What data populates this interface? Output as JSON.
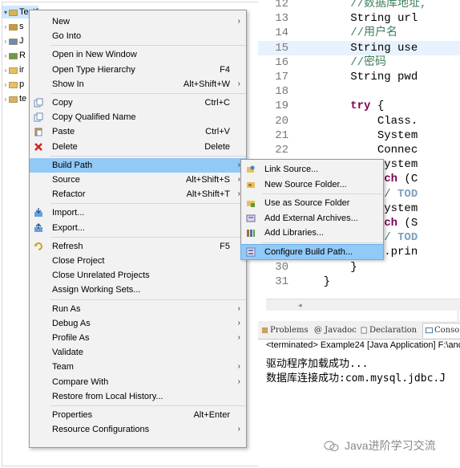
{
  "explorer": {
    "rows": [
      {
        "arrow": "▾",
        "label": "Test01"
      },
      {
        "arrow": "›",
        "label": "s"
      },
      {
        "arrow": "›",
        "label": "J"
      },
      {
        "arrow": "›",
        "label": "R"
      },
      {
        "arrow": "›",
        "label": "ir"
      },
      {
        "arrow": "›",
        "label": "p"
      },
      {
        "arrow": "›",
        "label": "te"
      }
    ]
  },
  "editor": {
    "lines": [
      {
        "no": "12",
        "parts": [
          {
            "t": "        ",
            "c": ""
          },
          {
            "t": "//数据库地址,",
            "c": "cmt"
          }
        ]
      },
      {
        "no": "13",
        "parts": [
          {
            "t": "        String url",
            "c": ""
          }
        ]
      },
      {
        "no": "14",
        "parts": [
          {
            "t": "        ",
            "c": ""
          },
          {
            "t": "//用户名",
            "c": "cmt"
          }
        ]
      },
      {
        "no": "15",
        "parts": [
          {
            "t": "        String use",
            "c": ""
          }
        ]
      },
      {
        "no": "16",
        "parts": [
          {
            "t": "        ",
            "c": ""
          },
          {
            "t": "//密码",
            "c": "cmt"
          }
        ]
      },
      {
        "no": "17",
        "parts": [
          {
            "t": "        String pwd",
            "c": ""
          }
        ]
      },
      {
        "no": "18",
        "parts": [
          {
            "t": "",
            "c": ""
          }
        ]
      },
      {
        "no": "19",
        "parts": [
          {
            "t": "        ",
            "c": ""
          },
          {
            "t": "try",
            "c": "kw"
          },
          {
            "t": " {",
            "c": ""
          }
        ]
      },
      {
        "no": "20",
        "parts": [
          {
            "t": "            Class.",
            "c": ""
          }
        ]
      },
      {
        "no": "21",
        "parts": [
          {
            "t": "            System",
            "c": ""
          }
        ]
      },
      {
        "no": "22",
        "parts": [
          {
            "t": "            Connec",
            "c": ""
          }
        ]
      },
      {
        "no": "23",
        "parts": [
          {
            "t": "            System",
            "c": ""
          }
        ]
      },
      {
        "no": "24",
        "parts": [
          {
            "t": "        } ",
            "c": ""
          },
          {
            "t": "catch",
            "c": "kw"
          },
          {
            "t": " (C",
            "c": ""
          }
        ]
      },
      {
        "no": "25",
        "parts": [
          {
            "t": "            // ",
            "c": "cmt"
          },
          {
            "t": "TOD",
            "c": "todo"
          }
        ]
      },
      {
        "no": "26",
        "parts": [
          {
            "t": "            System",
            "c": ""
          }
        ]
      },
      {
        "no": "27",
        "parts": [
          {
            "t": "        } ",
            "c": ""
          },
          {
            "t": "catch",
            "c": "kw"
          },
          {
            "t": " (S",
            "c": ""
          }
        ]
      },
      {
        "no": "28",
        "parts": [
          {
            "t": "            // ",
            "c": "cmt"
          },
          {
            "t": "TOD",
            "c": "todo"
          }
        ]
      },
      {
        "no": "29",
        "parts": [
          {
            "t": "            e.prin",
            "c": ""
          }
        ]
      },
      {
        "no": "30",
        "parts": [
          {
            "t": "        }",
            "c": ""
          }
        ]
      },
      {
        "no": "31",
        "parts": [
          {
            "t": "    }",
            "c": ""
          }
        ]
      }
    ]
  },
  "views": {
    "tabs": [
      "Problems",
      "@ Javadoc",
      "Declaration",
      "Conso"
    ],
    "console_header": "<terminated> Example24 [Java Application] F:\\anc",
    "console_lines": [
      "驱动程序加载成功...",
      "数据库连接成功:com.mysql.jdbc.J"
    ]
  },
  "context_menu": {
    "items": [
      {
        "label": "New",
        "accel": "",
        "submenu": true,
        "icon": ""
      },
      {
        "label": "Go Into",
        "accel": "",
        "submenu": false,
        "icon": ""
      },
      {
        "sep": true
      },
      {
        "label": "Open in New Window",
        "accel": "",
        "submenu": false,
        "icon": ""
      },
      {
        "label": "Open Type Hierarchy",
        "accel": "F4",
        "submenu": false,
        "icon": ""
      },
      {
        "label": "Show In",
        "accel": "Alt+Shift+W",
        "submenu": true,
        "icon": ""
      },
      {
        "sep": true
      },
      {
        "label": "Copy",
        "accel": "Ctrl+C",
        "submenu": false,
        "icon": "copy-icon"
      },
      {
        "label": "Copy Qualified Name",
        "accel": "",
        "submenu": false,
        "icon": "copy-icon"
      },
      {
        "label": "Paste",
        "accel": "Ctrl+V",
        "submenu": false,
        "icon": "paste-icon"
      },
      {
        "label": "Delete",
        "accel": "Delete",
        "submenu": false,
        "icon": "delete-icon"
      },
      {
        "sep": true
      },
      {
        "label": "Build Path",
        "accel": "",
        "submenu": true,
        "icon": "",
        "hover": true
      },
      {
        "label": "Source",
        "accel": "Alt+Shift+S",
        "submenu": true,
        "icon": ""
      },
      {
        "label": "Refactor",
        "accel": "Alt+Shift+T",
        "submenu": true,
        "icon": ""
      },
      {
        "sep": true
      },
      {
        "label": "Import...",
        "accel": "",
        "submenu": false,
        "icon": "import-icon"
      },
      {
        "label": "Export...",
        "accel": "",
        "submenu": false,
        "icon": "export-icon"
      },
      {
        "sep": true
      },
      {
        "label": "Refresh",
        "accel": "F5",
        "submenu": false,
        "icon": "refresh-icon"
      },
      {
        "label": "Close Project",
        "accel": "",
        "submenu": false,
        "icon": ""
      },
      {
        "label": "Close Unrelated Projects",
        "accel": "",
        "submenu": false,
        "icon": ""
      },
      {
        "label": "Assign Working Sets...",
        "accel": "",
        "submenu": false,
        "icon": ""
      },
      {
        "sep": true
      },
      {
        "label": "Run As",
        "accel": "",
        "submenu": true,
        "icon": ""
      },
      {
        "label": "Debug As",
        "accel": "",
        "submenu": true,
        "icon": ""
      },
      {
        "label": "Profile As",
        "accel": "",
        "submenu": true,
        "icon": ""
      },
      {
        "label": "Validate",
        "accel": "",
        "submenu": false,
        "icon": ""
      },
      {
        "label": "Team",
        "accel": "",
        "submenu": true,
        "icon": ""
      },
      {
        "label": "Compare With",
        "accel": "",
        "submenu": true,
        "icon": ""
      },
      {
        "label": "Restore from Local History...",
        "accel": "",
        "submenu": false,
        "icon": ""
      },
      {
        "sep": true
      },
      {
        "label": "Properties",
        "accel": "Alt+Enter",
        "submenu": false,
        "icon": ""
      },
      {
        "label": "Resource Configurations",
        "accel": "",
        "submenu": true,
        "icon": ""
      }
    ]
  },
  "build_path_menu": {
    "items": [
      {
        "label": "Link Source...",
        "icon": "link-source-icon"
      },
      {
        "label": "New Source Folder...",
        "icon": "new-source-folder-icon"
      },
      {
        "sep": true
      },
      {
        "label": "Use as Source Folder",
        "icon": "source-folder-icon"
      },
      {
        "label": "Add External Archives...",
        "icon": "archive-icon"
      },
      {
        "label": "Add Libraries...",
        "icon": "library-icon"
      },
      {
        "sep": true
      },
      {
        "label": "Configure Build Path...",
        "icon": "configure-icon",
        "hover": true
      }
    ]
  },
  "watermark": {
    "text": "Java进阶学习交流"
  },
  "colors": {
    "menu_bg": "#f2f2f2",
    "hover": "#91c9f7",
    "comment": "#3f7f5f",
    "keyword": "#7f0055"
  }
}
